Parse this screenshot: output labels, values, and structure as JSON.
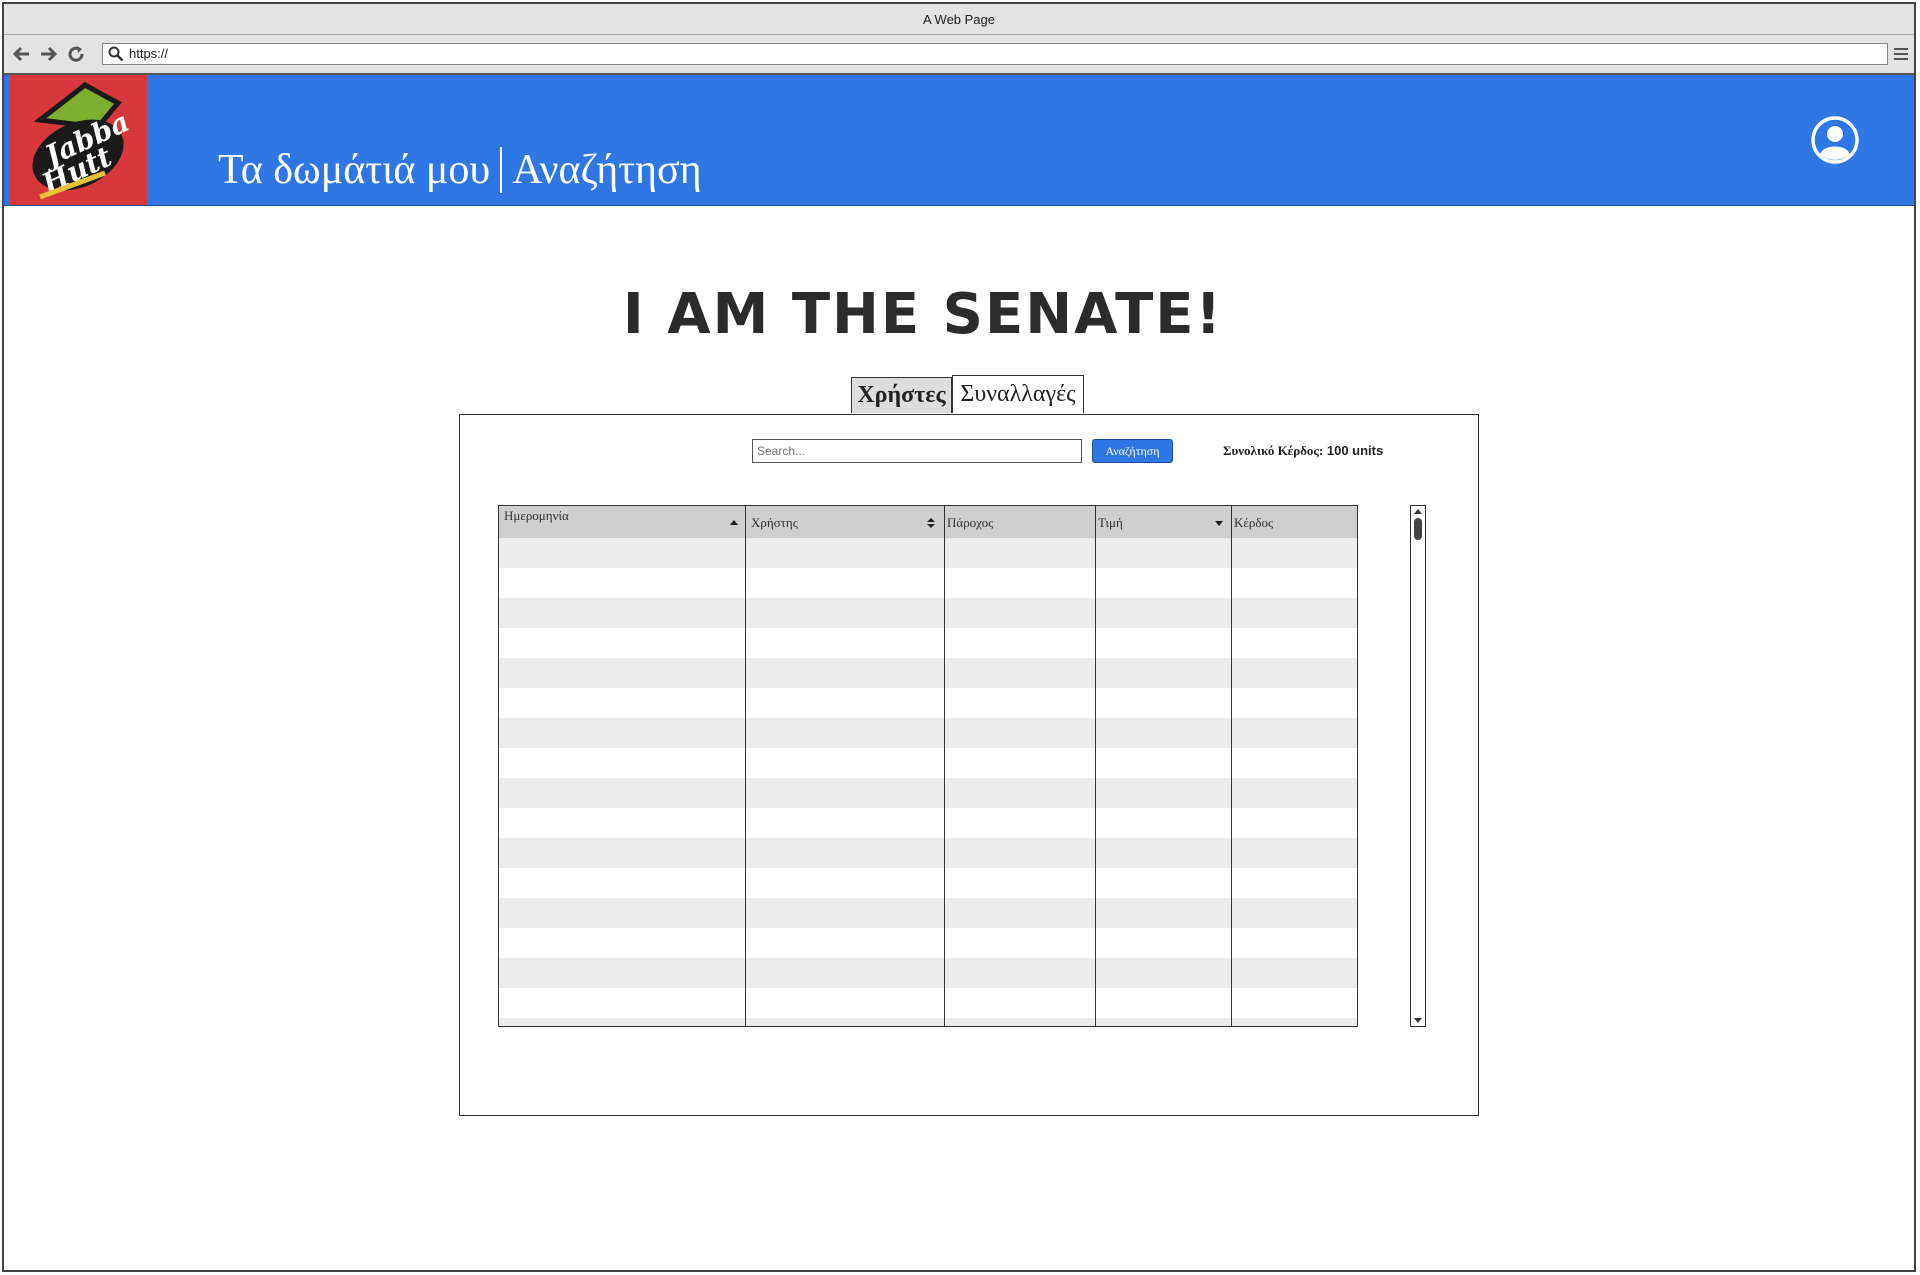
{
  "browser": {
    "title": "A Web Page",
    "url": "https://"
  },
  "header": {
    "logo_alt": "Jabba Hutt",
    "nav_rooms": "Τα δωμάτιά μου",
    "nav_search": "Αναζήτηση"
  },
  "page": {
    "title": "I AM THE SENATE!"
  },
  "tabs": [
    {
      "label": "Χρήστες"
    },
    {
      "label": "Συναλλαγές"
    }
  ],
  "filters": {
    "search_placeholder": "Search...",
    "search_button": "Αναζήτηση",
    "total_label": "Συνολικό Κέρδος:",
    "total_value": "100 units"
  },
  "table": {
    "columns": [
      {
        "label": "Ημερομηνία",
        "sort": "asc"
      },
      {
        "label": "Χρήστης",
        "sort": "both"
      },
      {
        "label": "Πάροχος",
        "sort": "none"
      },
      {
        "label": "Τιμή",
        "sort": "desc"
      },
      {
        "label": "Κέρδος",
        "sort": "none"
      }
    ]
  },
  "colors": {
    "header_blue": "#2e77e5",
    "logo_red": "#d8373b"
  }
}
